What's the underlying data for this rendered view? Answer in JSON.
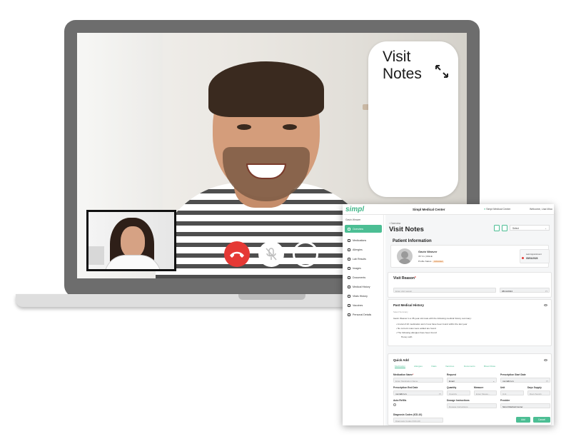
{
  "video_call": {
    "notes_overlay_title": "Visit Notes"
  },
  "app": {
    "logo": "simpl",
    "center_title": "Simpl Medical Center",
    "location": "Simpl Medical Center",
    "welcome": "Welcome, Lisa Woo",
    "sidebar": {
      "patient_label": "Gavin Weaver",
      "items": [
        {
          "label": "Overview"
        },
        {
          "label": "Medications"
        },
        {
          "label": "Allergies"
        },
        {
          "label": "Lab Results"
        },
        {
          "label": "Images"
        },
        {
          "label": "Documents"
        },
        {
          "label": "Medical History"
        },
        {
          "label": "Vitals History"
        },
        {
          "label": "Vaccines"
        },
        {
          "label": "Personal Details"
        }
      ]
    },
    "main": {
      "back_link": "Overview",
      "page_title": "Visit Notes",
      "header_select": "Select",
      "patient_info": {
        "title": "Patient Information",
        "name": "Gavin Weaver",
        "age_gender": "35 Yrs | MALE",
        "profile_status_label": "Profile Status",
        "profile_status_value": "Unfinished",
        "last_appointment_label": "Last Appointment",
        "last_appointment_value": "05/01/2023"
      },
      "visit_reason": {
        "title": "Visit Reason",
        "placeholder": "Enter visit reason",
        "date": "08/14/2024"
      },
      "past_history": {
        "title": "Past Medical History",
        "subtitle": "Select Summary",
        "intro": "Gavin Weaver is a 35-year-old male with the following medical history summary:",
        "bullets": [
          "A total of 22 medication and 2 new have been found within the last year",
          "No current notes were added are found",
          "The following allergies have been found:"
        ],
        "sub_bullet": "Honey with"
      },
      "quick_add": {
        "title": "Quick Add",
        "tabs": [
          "Medication",
          "Allergies",
          "Vitals",
          "Vaccines",
          "Documents",
          "Blood Draw"
        ],
        "medication_name_label": "Medication Name",
        "medication_name_placeholder": "Enter Medication Name",
        "request_label": "Request",
        "request_value": "Email",
        "prescription_start_label": "Prescription Start Date",
        "prescription_start_value": "mm/dd/yyyy",
        "prescription_end_label": "Prescription End Date",
        "prescription_end_value": "mm/dd/yyyy",
        "quantity_label": "Quantity",
        "quantity_value": "Quantity",
        "measure_label": "Measure",
        "measure_value": "Enter Measu...",
        "unit_label": "Unit",
        "unit_value": "Unit",
        "days_supply_label": "Days Supply",
        "days_supply_value": "Days Supply",
        "auto_refills_label": "Auto Refills",
        "dosage_label": "Dosage Instructions",
        "dosage_placeholder": "Dosage Instructions",
        "provider_label": "Provider",
        "provider_value": "Simpl Medical Center",
        "diagnosis_label": "Diagnosis Codes (ICD-10)",
        "diagnosis_placeholder": "Diagnosis Codes (ICD-10)",
        "add_button": "Add",
        "cancel_button": "Cancel"
      }
    }
  },
  "colors": {
    "accent": "#4cbe94",
    "hangup": "#e53935"
  }
}
